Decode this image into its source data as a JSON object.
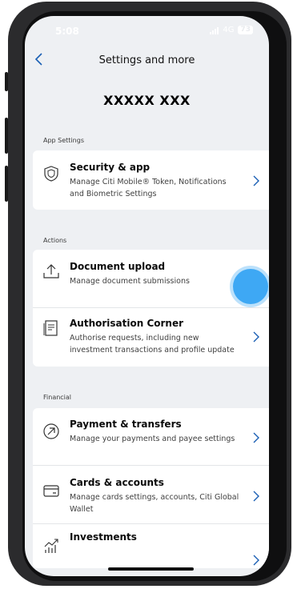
{
  "status_bar": {
    "time": "5:08",
    "network": "4G",
    "battery": "73"
  },
  "header": {
    "title": "Settings and more",
    "user_name": "XXXXX XXX"
  },
  "sections": {
    "app_settings": {
      "label": "App Settings",
      "items": [
        {
          "title": "Security & app",
          "description": "Manage Citi Mobile® Token, Notifications and Biometric Settings",
          "icon": "shield-icon"
        }
      ]
    },
    "actions": {
      "label": "Actions",
      "items": [
        {
          "title": "Document upload",
          "description": "Manage document submissions",
          "icon": "upload-icon"
        },
        {
          "title": "Authorisation Corner",
          "description": "Authorise requests, including new investment transactions and profile update",
          "icon": "document-icon"
        }
      ]
    },
    "financial": {
      "label": "Financial",
      "items": [
        {
          "title": "Payment & transfers",
          "description": "Manage your payments and payee settings",
          "icon": "payment-arrow-icon"
        },
        {
          "title": "Cards & accounts",
          "description": "Manage cards settings, accounts, Citi Global Wallet",
          "icon": "card-icon"
        },
        {
          "title": "Investments",
          "description": "",
          "icon": "investments-chart-icon"
        }
      ]
    }
  },
  "colors": {
    "screen_bg": "#eef0f3",
    "card_bg": "#ffffff",
    "chevron": "#1a5fb4",
    "touch_indicator": "#3ea8f4"
  }
}
